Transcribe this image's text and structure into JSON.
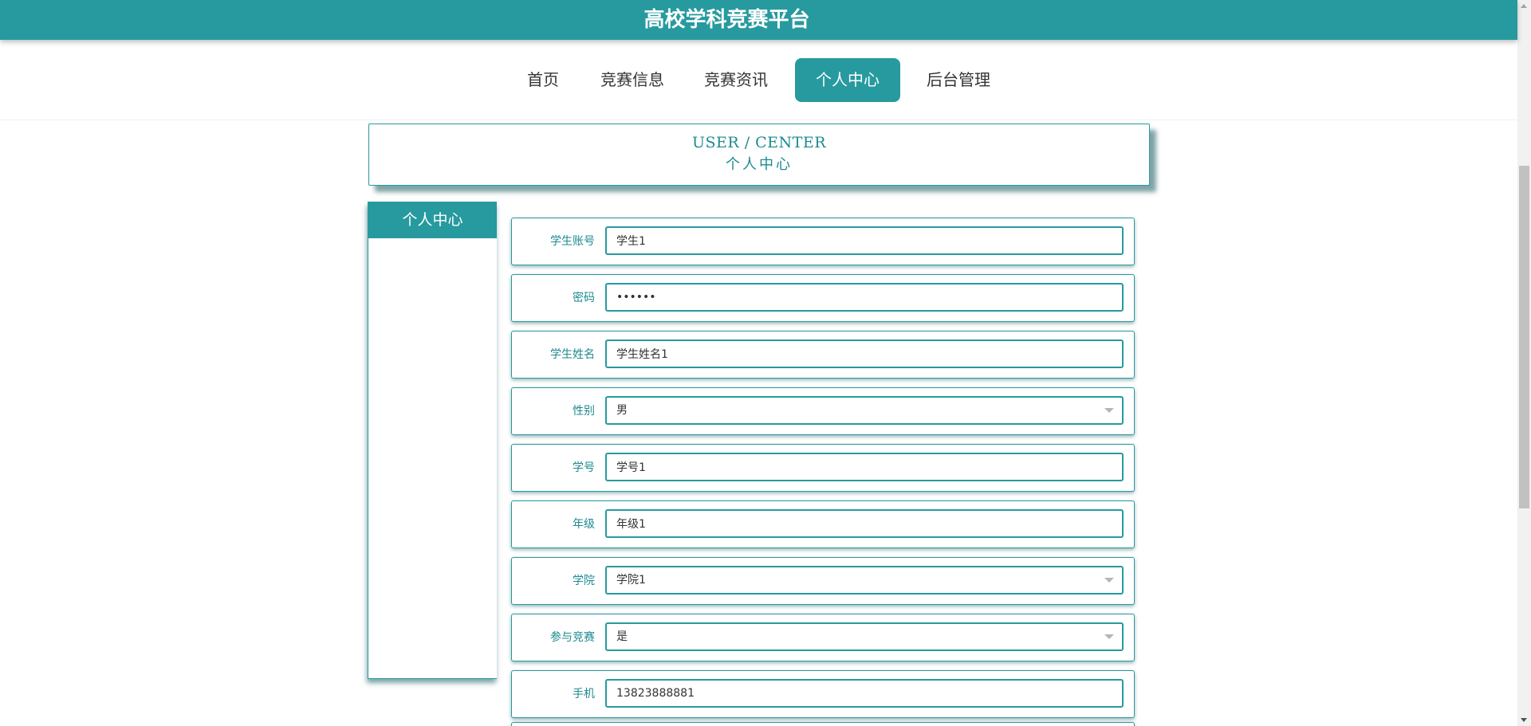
{
  "header": {
    "site_title": "高校学科竞赛平台"
  },
  "nav": {
    "items": [
      {
        "label": "首页",
        "active": false
      },
      {
        "label": "竞赛信息",
        "active": false
      },
      {
        "label": "竞赛资讯",
        "active": false
      },
      {
        "label": "个人中心",
        "active": true
      },
      {
        "label": "后台管理",
        "active": false
      }
    ]
  },
  "section_header": {
    "title_en": "USER / CENTER",
    "title_cn": "个人中心"
  },
  "sidebar": {
    "title": "个人中心"
  },
  "form": {
    "fields": [
      {
        "label": "学生账号",
        "type": "text",
        "value": "学生1"
      },
      {
        "label": "密码",
        "type": "password",
        "value": "123456"
      },
      {
        "label": "学生姓名",
        "type": "text",
        "value": "学生姓名1"
      },
      {
        "label": "性别",
        "type": "select",
        "value": "男"
      },
      {
        "label": "学号",
        "type": "text",
        "value": "学号1"
      },
      {
        "label": "年级",
        "type": "text",
        "value": "年级1"
      },
      {
        "label": "学院",
        "type": "select",
        "value": "学院1"
      },
      {
        "label": "参与竞赛",
        "type": "select",
        "value": "是"
      },
      {
        "label": "手机",
        "type": "text",
        "value": "13823888881"
      }
    ]
  },
  "colors": {
    "accent": "#279a9f",
    "label_text": "#1e8a90",
    "body_text": "#333333"
  }
}
